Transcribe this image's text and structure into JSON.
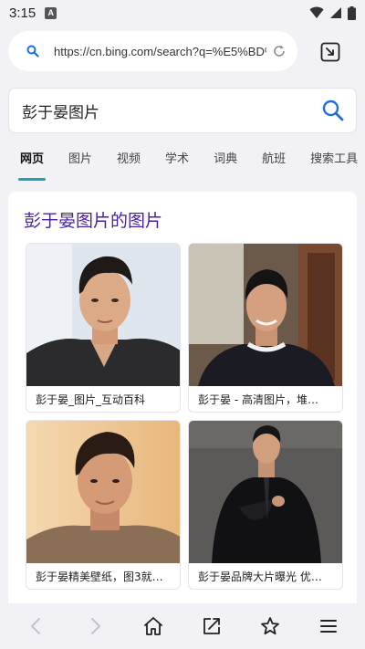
{
  "status_bar": {
    "time": "3:15",
    "notification_icon": "a-icon"
  },
  "url_bar": {
    "url": "https://cn.bing.com/search?q=%E5%BD%",
    "icons": [
      "search-icon",
      "reload-icon",
      "tab-switch-icon"
    ]
  },
  "search": {
    "query": "彭于晏图片"
  },
  "tabs": [
    {
      "label": "网页",
      "active": true
    },
    {
      "label": "图片",
      "active": false
    },
    {
      "label": "视频",
      "active": false
    },
    {
      "label": "学术",
      "active": false
    },
    {
      "label": "词典",
      "active": false
    },
    {
      "label": "航班",
      "active": false
    },
    {
      "label": "搜索工具",
      "active": false
    }
  ],
  "results": {
    "title": "彭于晏图片的图片",
    "images": [
      {
        "caption": "彭于晏_图片_互动百科"
      },
      {
        "caption": "彭于晏 - 高清图片，堆…"
      },
      {
        "caption": "彭于晏精美壁纸，图3就…"
      },
      {
        "caption": "彭于晏品牌大片曝光 优…"
      }
    ]
  },
  "bottom_nav": {
    "icons": [
      "back-icon",
      "forward-icon",
      "home-icon",
      "share-icon",
      "star-icon",
      "menu-icon"
    ]
  },
  "colors": {
    "accent": "#1aa3b6",
    "title": "#4a1fa0",
    "search_icon": "#1e6fd9"
  }
}
